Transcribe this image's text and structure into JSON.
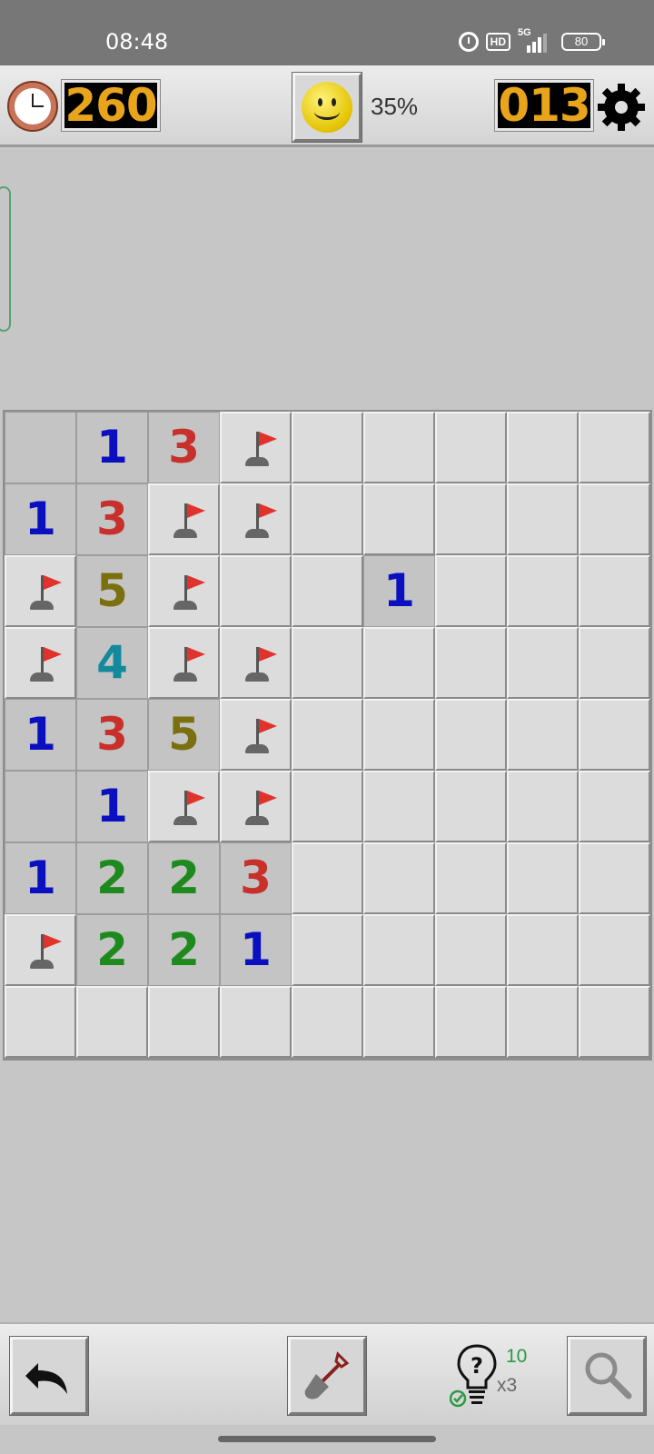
{
  "status_bar": {
    "time": "08:48",
    "hd_label": "HD",
    "network_label": "5G",
    "battery": "80",
    "icons": [
      "alarm-icon",
      "hd-icon",
      "signal-5g-icon",
      "battery-icon"
    ]
  },
  "header": {
    "timer": "260",
    "progress": "35%",
    "mines_remaining": "013",
    "icons": [
      "clock-icon",
      "smiley-face-icon",
      "gear-icon"
    ]
  },
  "board": {
    "cols": 9,
    "rows": 9,
    "legend": "h = unrevealed, f = flag, e = empty revealed, 1-8 = revealed number",
    "grid": [
      [
        "e",
        "1",
        "3",
        "f",
        "h",
        "h",
        "h",
        "h",
        "h"
      ],
      [
        "1",
        "3",
        "f",
        "f",
        "h",
        "h",
        "h",
        "h",
        "h"
      ],
      [
        "f",
        "5",
        "f",
        "h",
        "h",
        "1",
        "h",
        "h",
        "h"
      ],
      [
        "f",
        "4",
        "f",
        "f",
        "h",
        "h",
        "h",
        "h",
        "h"
      ],
      [
        "1",
        "3",
        "5",
        "f",
        "h",
        "h",
        "h",
        "h",
        "h"
      ],
      [
        "e",
        "1",
        "f",
        "f",
        "h",
        "h",
        "h",
        "h",
        "h"
      ],
      [
        "1",
        "2",
        "2",
        "3",
        "h",
        "h",
        "h",
        "h",
        "h"
      ],
      [
        "f",
        "2",
        "2",
        "1",
        "h",
        "h",
        "h",
        "h",
        "h"
      ],
      [
        "h",
        "h",
        "h",
        "h",
        "h",
        "h",
        "h",
        "h",
        "h"
      ]
    ],
    "number_colors": {
      "1": "#0a10c0",
      "2": "#1e8a1e",
      "3": "#c8302c",
      "4": "#138a9c",
      "5": "#7a7010"
    },
    "flag_color": "#e0332c"
  },
  "toolbar": {
    "hint_count": "10",
    "hint_multiplier": "x3",
    "icons": [
      "undo-icon",
      "shovel-icon",
      "lightbulb-hint-icon",
      "magnifier-icon"
    ]
  }
}
